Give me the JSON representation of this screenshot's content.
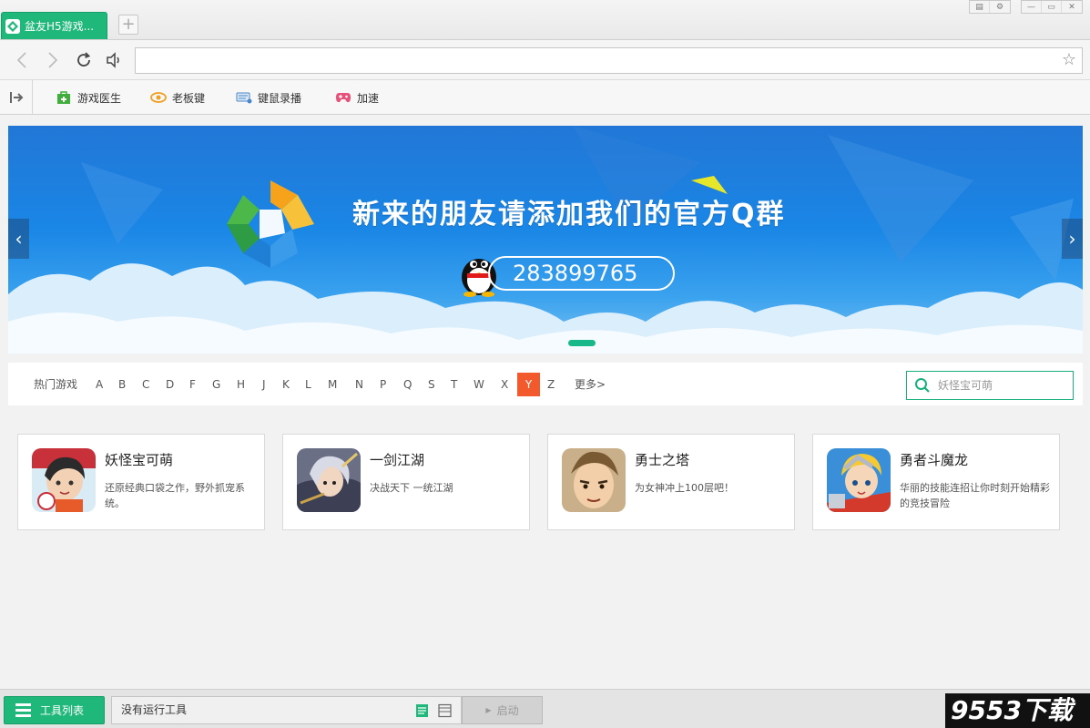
{
  "window": {
    "tab_title": "盆友H5游戏...",
    "new_tab_symbol": "+"
  },
  "navbar": {
    "address_value": ""
  },
  "toolbar": {
    "items": [
      {
        "label": "游戏医生",
        "icon": "medkit-icon"
      },
      {
        "label": "老板键",
        "icon": "eye-icon"
      },
      {
        "label": "键鼠录播",
        "icon": "keyboard-icon"
      },
      {
        "label": "加速",
        "icon": "gamepad-icon"
      }
    ]
  },
  "banner": {
    "title": "新来的朋友请添加我们的官方Q群",
    "qq_number": "283899765"
  },
  "filter": {
    "hot_label": "热门游戏",
    "letters": [
      "A",
      "B",
      "C",
      "D",
      "F",
      "G",
      "H",
      "J",
      "K",
      "L",
      "M",
      "N",
      "P",
      "Q",
      "S",
      "T",
      "W",
      "X",
      "Y",
      "Z"
    ],
    "active_letter": "Y",
    "more_label": "更多>",
    "search_placeholder": "妖怪宝可萌"
  },
  "games": [
    {
      "name": "妖怪宝可萌",
      "desc": "还原经典口袋之作，野外抓宠系统。"
    },
    {
      "name": "一剑江湖",
      "desc": "决战天下 一统江湖"
    },
    {
      "name": "勇士之塔",
      "desc": "为女神冲上100层吧！"
    },
    {
      "name": "勇者斗魔龙",
      "desc": "华丽的技能连招让你时刻开始精彩的竞技冒险"
    }
  ],
  "statusbar": {
    "tool_list_label": "工具列表",
    "running_text": "没有运行工具",
    "start_label": "启动"
  },
  "watermark": "9553下载",
  "colors": {
    "accent": "#1fb87a",
    "active_letter": "#f2592c",
    "banner_blue": "#1a86e6"
  }
}
